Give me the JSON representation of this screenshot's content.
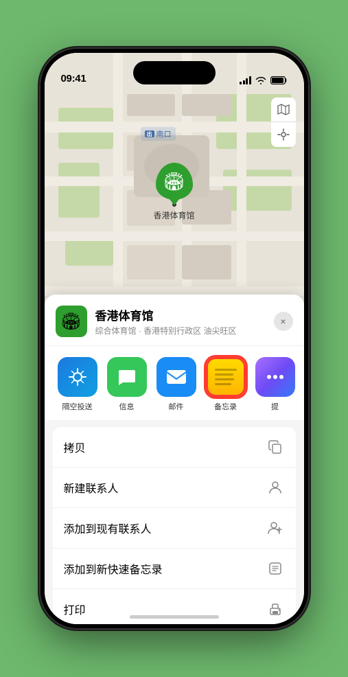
{
  "status_bar": {
    "time": "09:41",
    "location_arrow": "▲"
  },
  "map": {
    "nankou_label": "南口",
    "nankou_prefix": "出",
    "marker_label": "香港体育馆",
    "map_type_icon": "🗺",
    "location_icon": "⊕"
  },
  "venue_card": {
    "icon": "🏟",
    "name": "香港体育馆",
    "description": "综合体育馆 · 香港特别行政区 油尖旺区",
    "close_label": "×"
  },
  "share_apps": [
    {
      "key": "airdrop",
      "label": "隔空投送",
      "icon_type": "airdrop"
    },
    {
      "key": "messages",
      "label": "信息",
      "icon_type": "messages"
    },
    {
      "key": "mail",
      "label": "邮件",
      "icon_type": "mail"
    },
    {
      "key": "notes",
      "label": "备忘录",
      "icon_type": "notes"
    },
    {
      "key": "more",
      "label": "提",
      "icon_type": "more"
    }
  ],
  "actions": [
    {
      "label": "拷贝",
      "icon": "copy"
    },
    {
      "label": "新建联系人",
      "icon": "person"
    },
    {
      "label": "添加到现有联系人",
      "icon": "person-add"
    },
    {
      "label": "添加到新快速备忘录",
      "icon": "note"
    },
    {
      "label": "打印",
      "icon": "printer"
    }
  ]
}
